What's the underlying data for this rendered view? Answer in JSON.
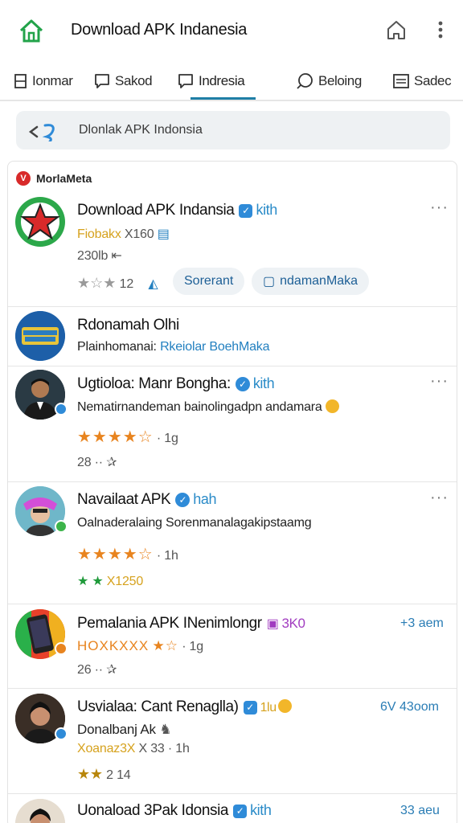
{
  "appbar": {
    "title": "Download APK Indanesia"
  },
  "tabs": [
    {
      "label": "Ionmar"
    },
    {
      "label": "Sakod"
    },
    {
      "label": "Indresia"
    },
    {
      "label": "Beloing"
    },
    {
      "label": "Sadec"
    }
  ],
  "search": {
    "text": "Dlonlak APK Indonsia"
  },
  "section": {
    "title": "MorlaMeta",
    "badge": "V"
  },
  "posts": [
    {
      "name": "Download APK Indansia",
      "tag": "kith",
      "line1": "Fiobakx",
      "line1b": "X160",
      "line2": "230lb",
      "rating_count": "12",
      "pill1": "Sorerant",
      "pill2": "ndamanMaka"
    },
    {
      "name": "Rdonamah Olhi",
      "line1": "Plainhomanai:",
      "line1b": "Rkeiolar BoehMaka"
    },
    {
      "name": "Ugtioloa: Manr Bongha:",
      "tag": "kith",
      "line1": "Nematirnandeman bainolingadpn andamara",
      "meta": "· 1g",
      "line3": "28 ··"
    },
    {
      "name": "Navailaat APK",
      "tag": "hah",
      "line1": "Oalnaderalaing Sorenmanalagakipstaamg",
      "meta": "· 1h",
      "line3": "X1250"
    },
    {
      "name": "Pemalania APK INenimlongr",
      "tag": "3K0",
      "time": "+3 aem",
      "line1": "HOXKXXX",
      "meta": "· 1g",
      "line3": "26 ··"
    },
    {
      "name": "Usvialaa: Cant Renaglla)",
      "tag": "1lu",
      "time": "6V 43oom",
      "line1": "Donalbanj Ak",
      "line2": "Xoanaz3X",
      "line2b": "X 33",
      "line2c": "· 1h",
      "line3": "2 14"
    },
    {
      "name": "Uonaload 3Pak Idonsia",
      "tag": "kith",
      "time": "33 aeu"
    }
  ],
  "colors": {
    "accent": "#1f7fa6",
    "verify": "#2f8bd8",
    "star_orange": "#e8841f",
    "home_green": "#22a34a"
  }
}
